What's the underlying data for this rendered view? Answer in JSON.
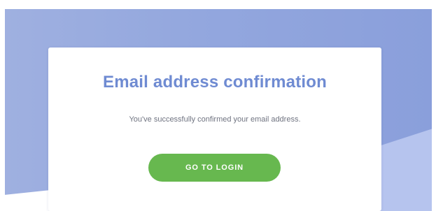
{
  "confirmation": {
    "title": "Email address confirmation",
    "message": "You've successfully confirmed your email address.",
    "login_button_label": "GO TO LOGIN"
  },
  "colors": {
    "background_blue": "#93a7de",
    "title_blue": "#6f8bd2",
    "button_green": "#67b84f",
    "message_gray": "#6f7380"
  }
}
